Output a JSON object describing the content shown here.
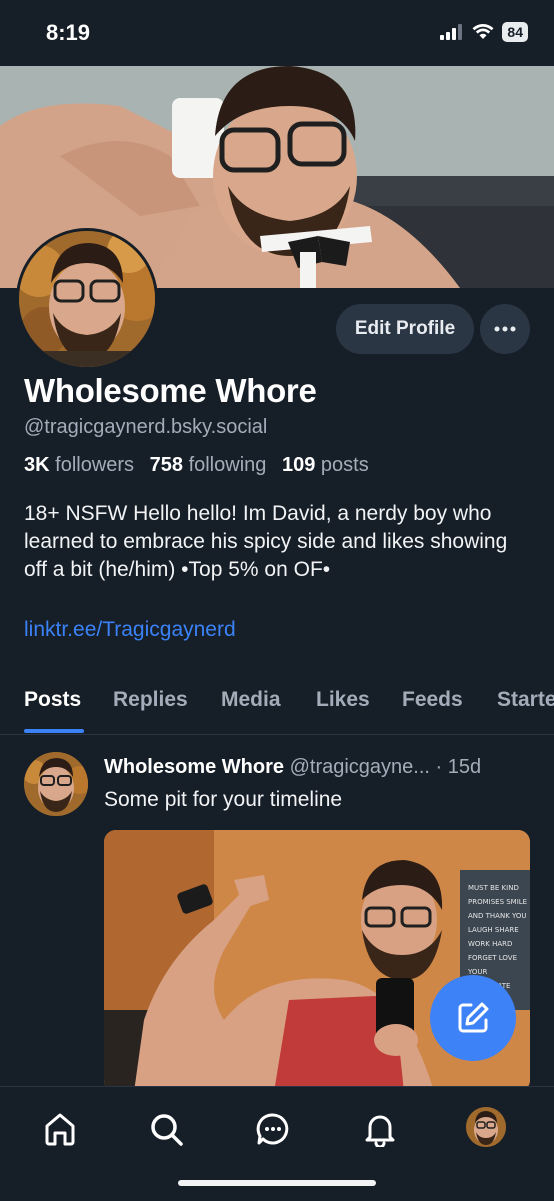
{
  "status_bar": {
    "time": "8:19",
    "battery": "84"
  },
  "profile": {
    "display_name": "Wholesome Whore",
    "handle": "@tragicgaynerd.bsky.social",
    "followers_count": "3K",
    "followers_label": "followers",
    "following_count": "758",
    "following_label": "following",
    "posts_count": "109",
    "posts_label": "posts",
    "bio": "18+ NSFW Hello hello! Im David, a nerdy boy who learned to embrace his spicy side and likes showing off a bit (he/him) •Top 5% on OF•",
    "link": "linktr.ee/Tragicgaynerd",
    "edit_button": "Edit Profile"
  },
  "tabs": [
    "Posts",
    "Replies",
    "Media",
    "Likes",
    "Feeds",
    "Starter"
  ],
  "active_tab": "Posts",
  "post": {
    "author_name": "Wholesome Whore",
    "author_handle": "@tragicgayne...",
    "time": "· 15d",
    "text": "Some pit for your timeline",
    "poster_text": "MUST BE KIND / PROMISES SMILE / AND THANK YOU / LAUGH SHARE / WORK HARD / FORGET LOVE / YOUR / APPRECIATE"
  },
  "nav": [
    "home-icon",
    "search-icon",
    "chat-icon",
    "bell-icon",
    "profile-avatar"
  ],
  "colors": {
    "background": "#161e27",
    "accent": "#3b82f6",
    "button": "#2b3645",
    "muted_text": "#a3adba"
  }
}
